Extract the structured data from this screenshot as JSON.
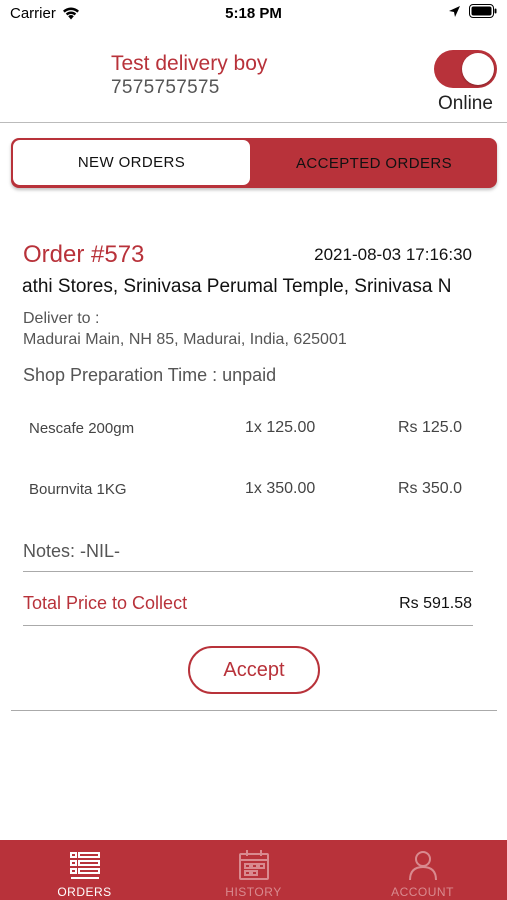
{
  "status_bar": {
    "carrier": "Carrier",
    "time": "5:18 PM"
  },
  "header": {
    "driver_name": "Test delivery boy",
    "driver_phone": "7575757575",
    "status_label": "Online",
    "online": true
  },
  "tabs": {
    "new_orders": "NEW ORDERS",
    "accepted_orders": "ACCEPTED ORDERS",
    "active": "new_orders"
  },
  "order": {
    "number": "Order #573",
    "date": "2021-08-03 17:16:30",
    "shop_line": "athi Stores, Srinivasa Perumal Temple, Srinivasa N",
    "deliver_label": "Deliver to :",
    "deliver_address": "Madurai Main, NH 85, Madurai, India, 625001",
    "prep_time": "Shop Preparation Time : unpaid",
    "items": [
      {
        "name": "Nescafe 200gm",
        "qty": "1x 125.00",
        "total": "Rs 125.0"
      },
      {
        "name": "Bournvita 1KG",
        "qty": "1x 350.00",
        "total": "Rs 350.0"
      }
    ],
    "notes": "Notes: -NIL-",
    "total_label": "Total Price to Collect",
    "total_value": "Rs 591.58",
    "accept_label": "Accept"
  },
  "bottom_nav": {
    "items": [
      {
        "label": "ORDERS",
        "icon": "orders-list-icon",
        "active": true
      },
      {
        "label": "HISTORY",
        "icon": "calendar-icon",
        "active": false
      },
      {
        "label": "ACCOUNT",
        "icon": "user-icon",
        "active": false
      }
    ]
  },
  "colors": {
    "accent": "#b8323a",
    "inactive_nav": "#d98a8f"
  }
}
